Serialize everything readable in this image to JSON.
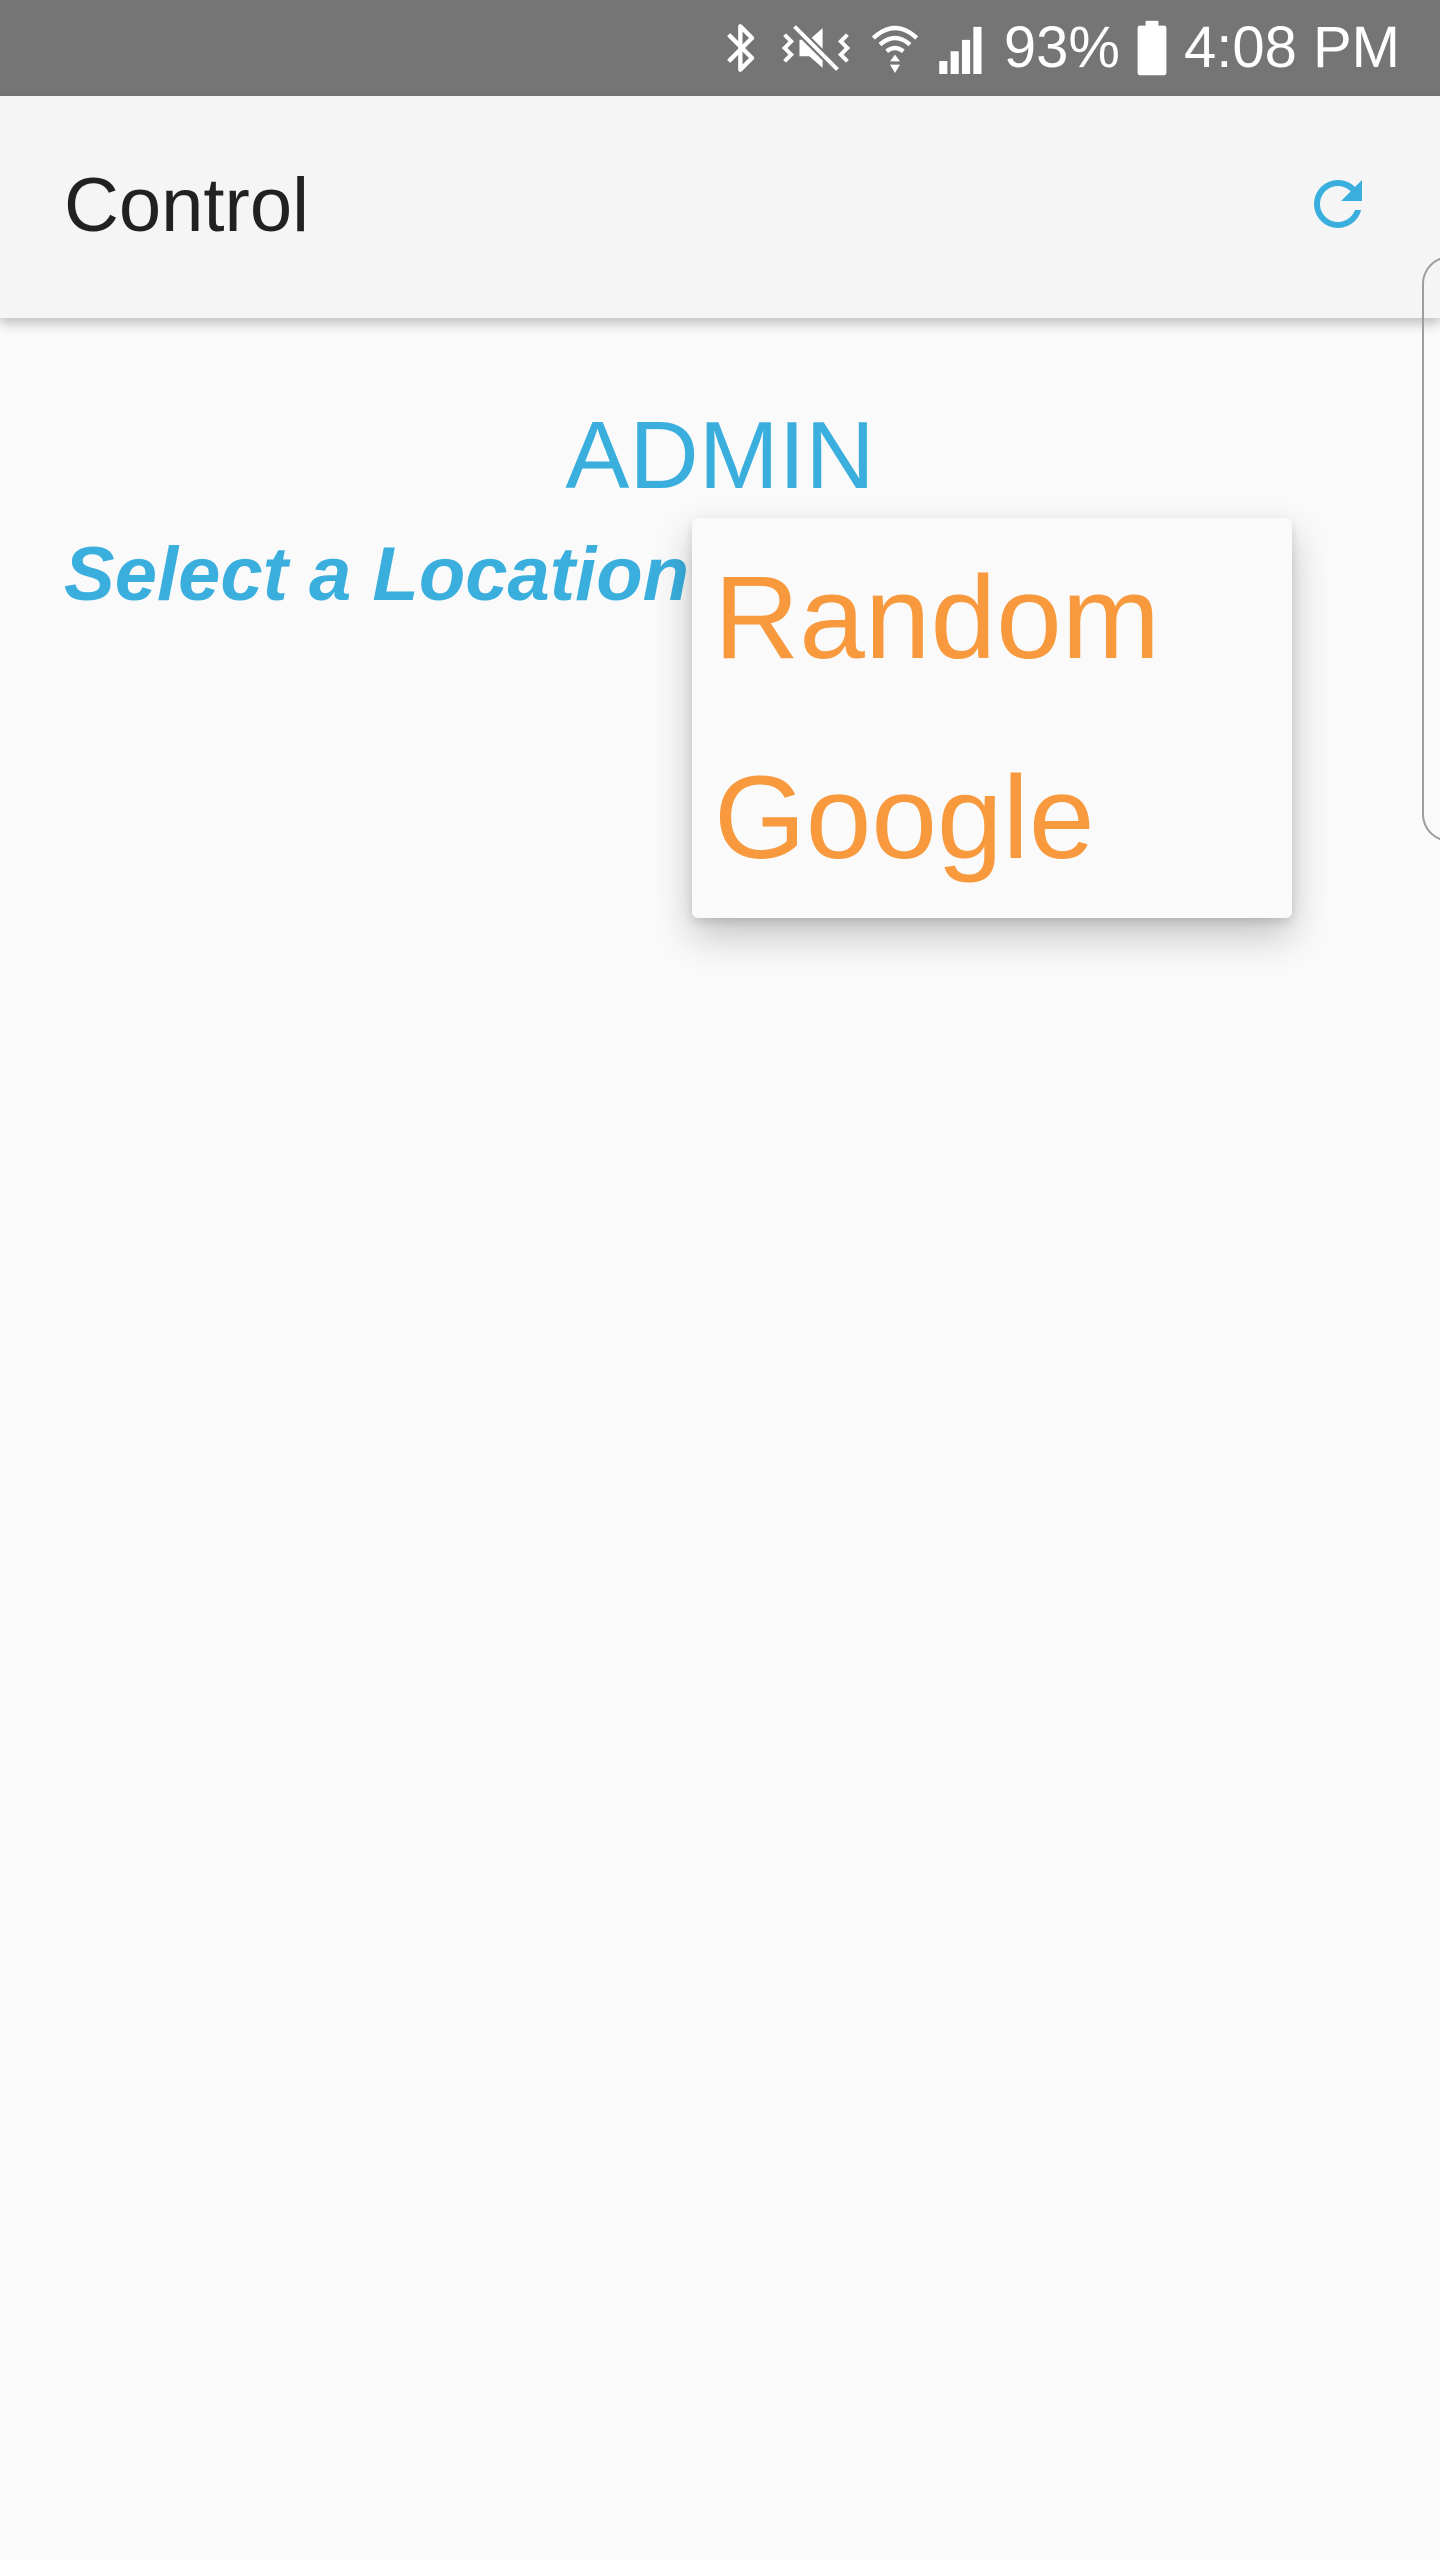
{
  "status_bar": {
    "battery_percent": "93%",
    "time": "4:08 PM",
    "icons": [
      "bluetooth-icon",
      "mute-vibrate-icon",
      "wifi-icon",
      "signal-icon",
      "battery-icon"
    ]
  },
  "app_bar": {
    "title": "Control",
    "refresh_icon": "refresh-icon"
  },
  "main": {
    "role": "ADMIN",
    "select_location_label": "Select a Location"
  },
  "dropdown": {
    "options": [
      "Random",
      "Google"
    ]
  },
  "colors": {
    "status_bar_bg": "#757575",
    "app_bar_bg": "#f5f5f5",
    "accent_blue": "#3aafde",
    "option_orange": "#f7993c",
    "background": "#fafafa"
  }
}
